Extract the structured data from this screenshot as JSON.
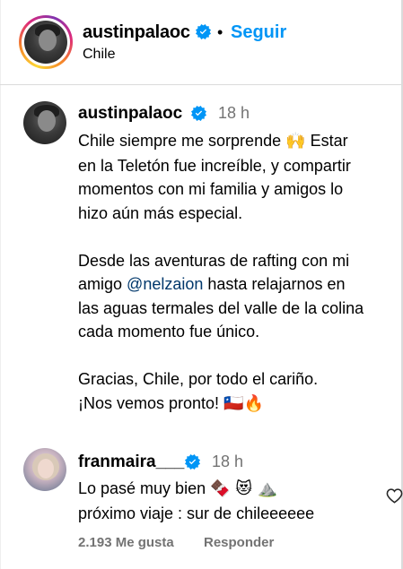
{
  "header": {
    "username": "austinpalaoc",
    "dot": "•",
    "follow_label": "Seguir",
    "location": "Chile"
  },
  "caption": {
    "username": "austinpalaoc",
    "time": "18 h",
    "line1": "Chile siempre me sorprende",
    "line1_emoji": "🙌",
    "line1_tail": "Estar",
    "line2": "en la Teletón fue increíble, y compartir",
    "line3": "momentos con mi familia y amigos lo",
    "line4": "hizo aún más especial.",
    "line5": "Desde las aventuras de rafting con mi",
    "line6_pre": "amigo",
    "line6_mention": "@nelzaion",
    "line6_post": "hasta relajarnos en",
    "line7": "las aguas termales del valle de la colina",
    "line8": "cada momento fue único.",
    "line9": "Gracias, Chile, por todo el cariño.",
    "line10": "¡Nos vemos pronto!",
    "line10_emoji1": "🇨🇱",
    "line10_emoji2": "🔥"
  },
  "comment": {
    "username": "franmaira___",
    "time": "18 h",
    "line1": "Lo pasé muy bien",
    "line1_emojis": "🍫 😻 ⛰️",
    "line2": "próximo viaje : sur de chileeeeee",
    "likes": "2.193 Me gusta",
    "reply_label": "Responder"
  },
  "icons": {
    "verified": "verified-badge-icon",
    "like": "heart-outline-icon"
  },
  "colors": {
    "accent": "#0095f6",
    "verified": "#0095f6",
    "mention": "#00376b",
    "muted": "#737373"
  }
}
